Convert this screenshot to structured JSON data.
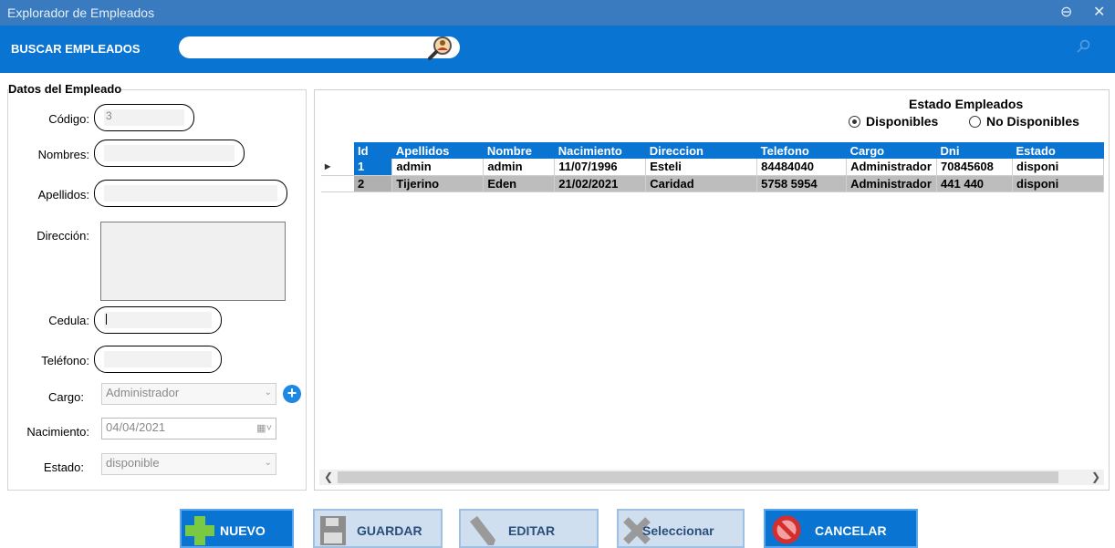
{
  "window": {
    "title": "Explorador de Empleados",
    "minimize_glyph": "⊖",
    "close_glyph": "✕"
  },
  "search": {
    "label": "BUSCAR EMPLEADOS",
    "value": "",
    "placeholder": ""
  },
  "form": {
    "legend": "Datos del Empleado",
    "codigo_label": "Código:",
    "codigo_value": "3",
    "nombres_label": "Nombres:",
    "apellidos_label": "Apellidos:",
    "direccion_label": "Dirección:",
    "cedula_label": "Cedula:",
    "telefono_label": "Teléfono:",
    "cargo_label": "Cargo:",
    "cargo_value": "Administrador",
    "nacimiento_label": "Nacimiento:",
    "nacimiento_value": "04/04/2021",
    "estado_label": "Estado:",
    "estado_value": "disponible"
  },
  "estado_filter": {
    "title": "Estado Empleados",
    "option_disponibles": "Disponibles",
    "option_no_disponibles": "No Disponibles",
    "selected": "Disponibles"
  },
  "table": {
    "columns": [
      "Id",
      "Apellidos",
      "Nombre",
      "Nacimiento",
      "Direccion",
      "Telefono",
      "Cargo",
      "Dni",
      "Estado"
    ],
    "rows": [
      [
        "1",
        "admin",
        "admin",
        "11/07/1996",
        "Esteli",
        "84484040",
        "Administrador",
        "70845608",
        "disponi"
      ],
      [
        "2",
        "Tijerino",
        "Eden",
        "21/02/2021",
        "Caridad",
        "5758 5954",
        "Administrador",
        "441 440",
        "disponi"
      ]
    ]
  },
  "buttons": {
    "nuevo": "NUEVO",
    "guardar": "GUARDAR",
    "editar": "EDITAR",
    "seleccionar": "Seleccionar",
    "cancelar": "CANCELAR"
  },
  "colors": {
    "header_blue": "#0a74d2",
    "title_blue": "#3a7bbf",
    "selected_row": "#bdbdbd"
  },
  "icons": {
    "add": "plus-icon",
    "save": "floppy-disk-icon",
    "edit": "pencil-icon",
    "select": "x-mark-icon",
    "cancel": "prohibited-icon",
    "search": "user-search-icon"
  }
}
